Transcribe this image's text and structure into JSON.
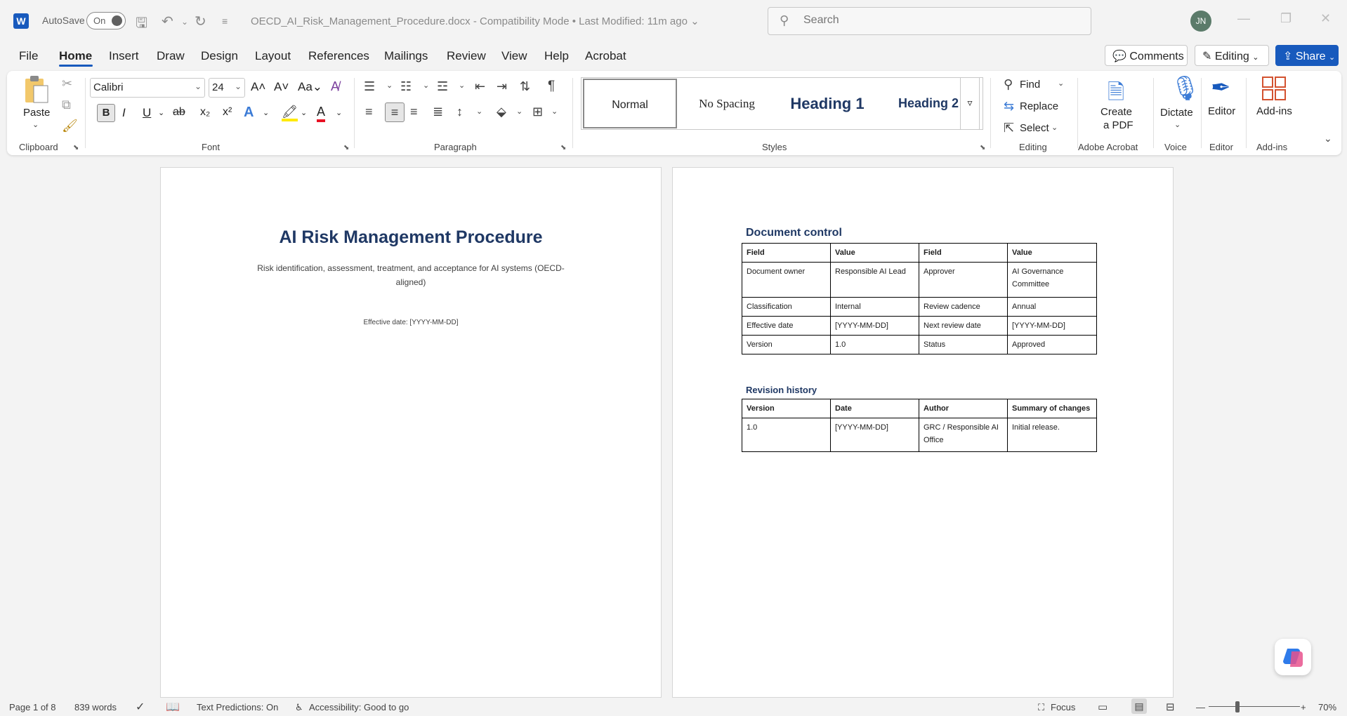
{
  "titlebar": {
    "autosave_label": "AutoSave",
    "autosave_state": "On",
    "document_title": "OECD_AI_Risk_Management_Procedure.docx  -  Compatibility Mode  •  Last Modified: 11m ago ⌄",
    "search_placeholder": "Search",
    "user_initials": "JN"
  },
  "menu": {
    "tabs": [
      "File",
      "Home",
      "Insert",
      "Draw",
      "Design",
      "Layout",
      "References",
      "Mailings",
      "Review",
      "View",
      "Help",
      "Acrobat"
    ],
    "comments_label": "Comments",
    "editing_label": "Editing",
    "share_label": "Share"
  },
  "ribbon": {
    "clipboard": {
      "label": "Clipboard",
      "paste": "Paste"
    },
    "font": {
      "label": "Font",
      "family": "Calibri",
      "size": "24"
    },
    "paragraph": {
      "label": "Paragraph"
    },
    "styles": {
      "label": "Styles",
      "items": [
        "Normal",
        "No Spacing",
        "Heading 1",
        "Heading 2"
      ]
    },
    "editing": {
      "label": "Editing",
      "find": "Find",
      "replace": "Replace",
      "select": "Select"
    },
    "acrobat": {
      "label": "Adobe Acrobat",
      "create_pdf_line1": "Create",
      "create_pdf_line2": "a PDF"
    },
    "voice": {
      "label": "Voice",
      "dictate": "Dictate"
    },
    "editor": {
      "label": "Editor",
      "editor": "Editor"
    },
    "addins": {
      "label": "Add-ins",
      "addins": "Add-ins"
    }
  },
  "page1": {
    "title": "AI Risk Management Procedure",
    "subtitle": "Risk identification, assessment, treatment, and acceptance for AI systems (OECD-aligned)",
    "effective_date": "Effective date: [YYYY-MM-DD]"
  },
  "page2": {
    "doc_control_heading": "Document control",
    "doc_control_table": [
      [
        "Field",
        "Value",
        "Field",
        "Value"
      ],
      [
        "Document owner",
        "Responsible AI Lead",
        "Approver",
        "AI Governance Committee"
      ],
      [
        "Classification",
        "Internal",
        "Review cadence",
        "Annual"
      ],
      [
        "Effective date",
        "[YYYY-MM-DD]",
        "Next review date",
        "[YYYY-MM-DD]"
      ],
      [
        "Version",
        "1.0",
        "Status",
        "Approved"
      ]
    ],
    "revision_heading": "Revision history",
    "revision_table": [
      [
        "Version",
        "Date",
        "Author",
        "Summary of changes"
      ],
      [
        "1.0",
        "[YYYY-MM-DD]",
        "GRC / Responsible AI Office",
        "Initial release."
      ]
    ]
  },
  "statusbar": {
    "page": "Page 1 of 8",
    "words": "839 words",
    "text_predictions": "Text Predictions: On",
    "accessibility": "Accessibility: Good to go",
    "focus": "Focus",
    "zoom": "70%"
  }
}
